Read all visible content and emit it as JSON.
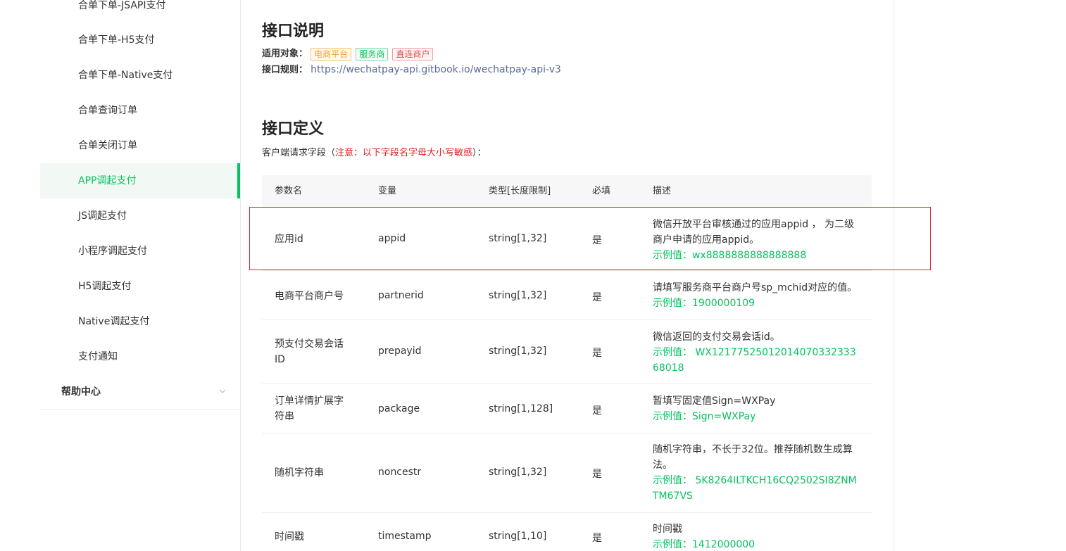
{
  "sidebar": {
    "items": [
      {
        "label": "合单下单-JSAPI支付",
        "active": false
      },
      {
        "label": "合单下单-H5支付",
        "active": false
      },
      {
        "label": "合单下单-Native支付",
        "active": false
      },
      {
        "label": "合单查询订单",
        "active": false
      },
      {
        "label": "合单关闭订单",
        "active": false
      },
      {
        "label": "APP调起支付",
        "active": true
      },
      {
        "label": "JS调起支付",
        "active": false
      },
      {
        "label": "小程序调起支付",
        "active": false
      },
      {
        "label": "H5调起支付",
        "active": false
      },
      {
        "label": "Native调起支付",
        "active": false
      },
      {
        "label": "支付通知",
        "active": false
      }
    ],
    "group": {
      "label": "帮助中心",
      "icon": "chevron-down-icon"
    }
  },
  "section1": {
    "title": "接口说明",
    "applicable_label": "适用对象：",
    "tags": [
      "电商平台",
      "服务商",
      "直连商户"
    ],
    "rules_label": "接口规则：",
    "rules_link": "https://wechatpay-api.gitbook.io/wechatpay-api-v3"
  },
  "section2": {
    "title": "接口定义",
    "note_prefix": "客户端请求字段（",
    "note_warn": "注意：以下字段名字母大小写敏感",
    "note_suffix": "）："
  },
  "table": {
    "headers": [
      "参数名",
      "变量",
      "类型[长度限制]",
      "必填",
      "描述"
    ],
    "rows": [
      {
        "name": "应用id",
        "var": "appid",
        "type": "string[1,32]",
        "required": "是",
        "desc": "微信开放平台审核通过的应用appid ， 为二级商户申请的应用appid。",
        "example": "示例值：wx8888888888888888"
      },
      {
        "name": "电商平台商户号",
        "var": "partnerid",
        "type": "string[1,32]",
        "required": "是",
        "desc": "请填写服务商平台商户号sp_mchid对应的值。",
        "example": "示例值：1900000109"
      },
      {
        "name": "预支付交易会话ID",
        "var": "prepayid",
        "type": "string[1,32]",
        "required": "是",
        "desc": "微信返回的支付交易会话id。",
        "example": "示例值： WX1217752501201407033233368018"
      },
      {
        "name": "订单详情扩展字符串",
        "var": "package",
        "type": "string[1,128]",
        "required": "是",
        "desc": "暂填写固定值Sign=WXPay",
        "example": "示例值：Sign=WXPay"
      },
      {
        "name": "随机字符串",
        "var": "noncestr",
        "type": "string[1,32]",
        "required": "是",
        "desc": "随机字符串，不长于32位。推荐随机数生成算法。",
        "example": "示例值： 5K8264ILTKCH16CQ2502SI8ZNMTM67VS"
      },
      {
        "name": "时间戳",
        "var": "timestamp",
        "type": "string[1,10]",
        "required": "是",
        "desc": "时间戳",
        "example": "示例值：1412000000"
      }
    ]
  },
  "colors": {
    "accent": "#07c160",
    "link": "#576b95",
    "warn": "#e02020",
    "highlight": "#d9272e"
  }
}
